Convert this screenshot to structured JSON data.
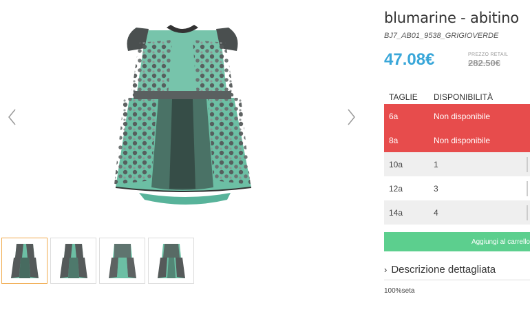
{
  "product": {
    "title": "blumarine - abitino",
    "sku": "BJ7_AB01_9538_GRIGIOVERDE",
    "price": "47.08€",
    "retail_label": "PREZZO RETAIL",
    "retail_price": "282.50€"
  },
  "sizes_table": {
    "headers": [
      "TAGLIE",
      "DISPONIBILITÀ"
    ],
    "rows": [
      {
        "size": "6a",
        "availability": "Non disponibile",
        "status": "unavailable"
      },
      {
        "size": "8a",
        "availability": "Non disponibile",
        "status": "unavailable"
      },
      {
        "size": "10a",
        "availability": "1",
        "status": "available"
      },
      {
        "size": "12a",
        "availability": "3",
        "status": "available"
      },
      {
        "size": "14a",
        "availability": "4",
        "status": "available"
      }
    ]
  },
  "cart": {
    "label": "Aggiungi al carrello"
  },
  "description": {
    "toggle_label": "Descrizione dettagliata",
    "text": "100%seta"
  },
  "gallery": {
    "thumbnail_count": 4,
    "active_index": 0
  },
  "colors": {
    "price": "#3aa7d9",
    "unavailable": "#e74c4c",
    "cart": "#5ccf8e",
    "active_thumb": "#f0a94a"
  }
}
